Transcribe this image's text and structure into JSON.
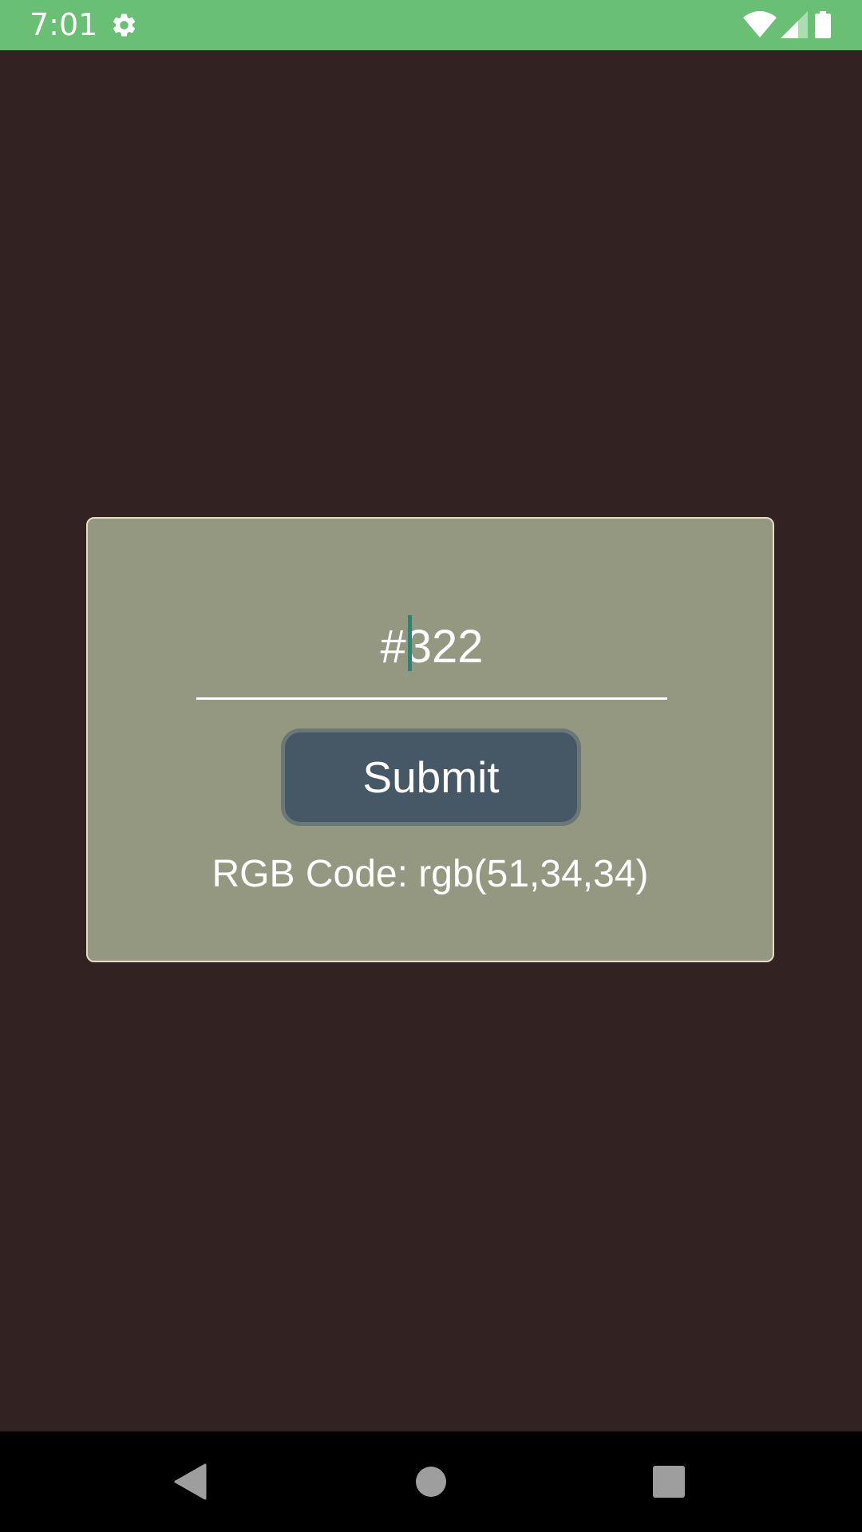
{
  "status_bar": {
    "time": "7:01",
    "background_color": "#69BF73",
    "icons": [
      "gear-icon",
      "wifi-icon",
      "signal-icon",
      "battery-icon"
    ]
  },
  "card": {
    "background_color": "#949881",
    "hex_input": {
      "value": "#322"
    },
    "submit_label": "Submit",
    "rgb_result": "RGB Code: rgb(51,34,34)"
  },
  "page_background": "#332222",
  "nav_bar": {
    "icons": [
      "back-icon",
      "home-icon",
      "recents-icon"
    ]
  }
}
